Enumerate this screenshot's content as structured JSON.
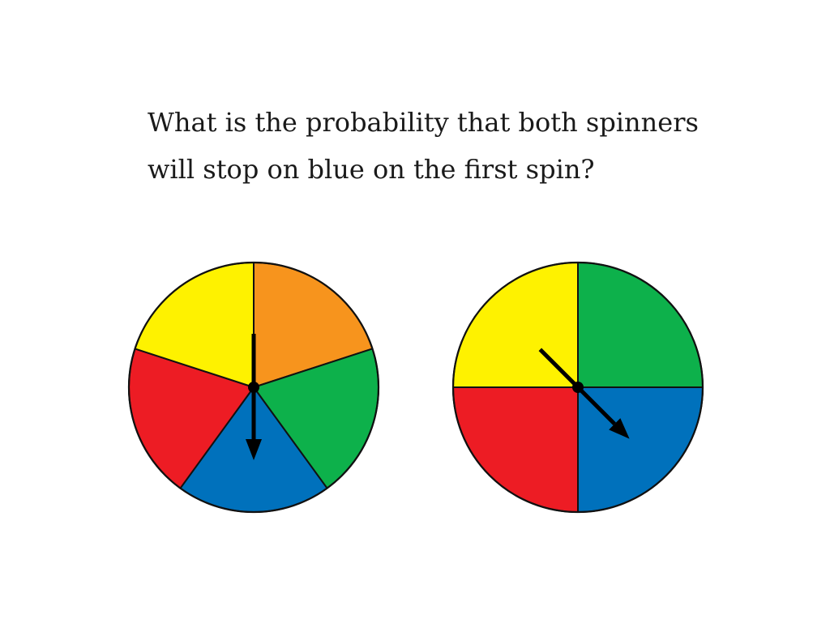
{
  "question": {
    "line1": "What is the probability that both spinners",
    "line2": "will stop on blue on the first spin?"
  },
  "colors": {
    "yellow": "#fef200",
    "orange": "#f7941d",
    "green": "#0db14b",
    "blue": "#0071bc",
    "red": "#ed1c24",
    "outline": "#111111",
    "arrow": "#000000"
  },
  "spinners": [
    {
      "sections": [
        "orange",
        "green",
        "blue",
        "red",
        "yellow"
      ],
      "arrow_points_to": "blue"
    },
    {
      "sections": [
        "green",
        "blue",
        "red",
        "yellow"
      ],
      "arrow_points_to": "blue"
    }
  ]
}
